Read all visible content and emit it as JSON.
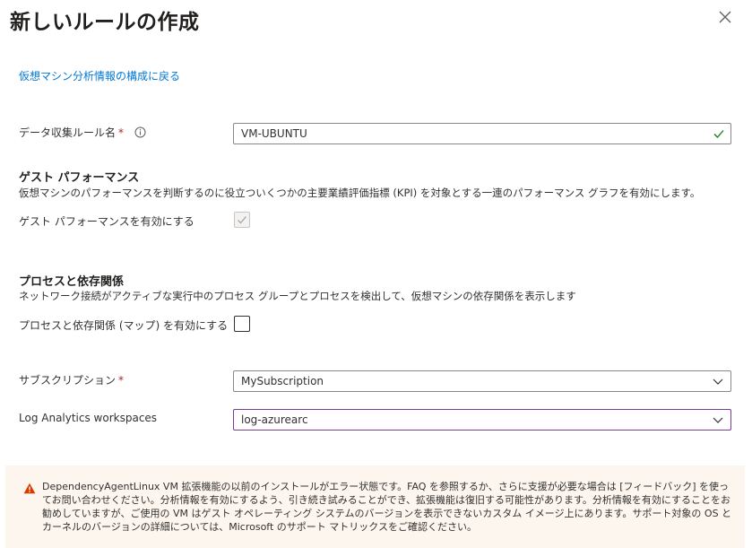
{
  "title": "新しいルールの作成",
  "back_link": "仮想マシン分析情報の構成に戻る",
  "rule_name": {
    "label": "データ収集ルール名",
    "required_mark": "*",
    "value": "VM-UBUNTU"
  },
  "guest_performance": {
    "title": "ゲスト パフォーマンス",
    "description": "仮想マシンのパフォーマンスを判断するのに役立ついくつかの主要業績評価指標 (KPI) を対象とする一連のパフォーマンス グラフを有効にします。",
    "enable_label": "ゲスト パフォーマンスを有効にする",
    "checked": true,
    "disabled": true
  },
  "process_dependency": {
    "title": "プロセスと依存関係",
    "description": "ネットワーク接続がアクティブな実行中のプロセス グループとプロセスを検出して、仮想マシンの依存関係を表示します",
    "enable_label": "プロセスと依存関係 (マップ) を有効にする",
    "checked": false
  },
  "subscription": {
    "label": "サブスクリプション",
    "required_mark": "*",
    "value": "MySubscription"
  },
  "workspace": {
    "label": "Log Analytics workspaces",
    "value": "log-azurearc"
  },
  "warning": {
    "text": "DependencyAgentLinux VM 拡張機能の以前のインストールがエラー状態です。FAQ を参照するか、さらに支援が必要な場合は [フィードバック] を使ってお問い合わせください。分析情報を有効にするよう、引き続き試みることができ、拡張機能は復旧する可能性があります。分析情報を有効にすることをお勧めしていますが、ご使用の VM はゲスト オペレーティング システムのバージョンを表示できないカスタム イメージ上にあります。サポート対象の OS とカーネルのバージョンの詳細については、Microsoft のサポート マトリックスをご確認ください。"
  },
  "colors": {
    "link": "#0078d4",
    "required": "#a4262c",
    "valid_check": "#107c10",
    "warning_bg": "#fdf6ee",
    "warning_icon": "#d83b01"
  }
}
